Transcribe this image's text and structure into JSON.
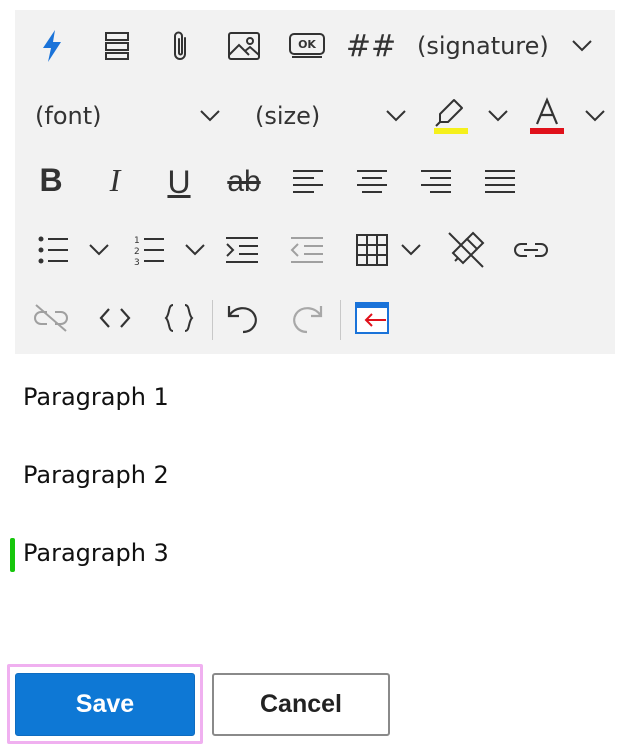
{
  "toolbar": {
    "row1": {
      "quick_action_icon": "lightning-icon",
      "blocks_icon": "stacked-blocks-icon",
      "attach_icon": "paperclip-icon",
      "image_icon": "image-icon",
      "ok_button_label": "OK",
      "hash_label": "##",
      "signature_label": "(signature)"
    },
    "row2": {
      "font_label": "(font)",
      "size_label": "(size)",
      "highlight_color": "#f5f01c",
      "font_color": "#e0111b"
    },
    "row3": {
      "bold_label": "B",
      "italic_label": "I",
      "underline_label": "U",
      "strike_label": "ab"
    }
  },
  "editor": {
    "paragraphs": [
      "Paragraph 1",
      "Paragraph 2",
      "Paragraph 3"
    ],
    "caret_color": "#16c60c"
  },
  "actions": {
    "save_label": "Save",
    "cancel_label": "Cancel",
    "accent": "#0e78d5",
    "focus_ring": "#f0b0f0"
  }
}
